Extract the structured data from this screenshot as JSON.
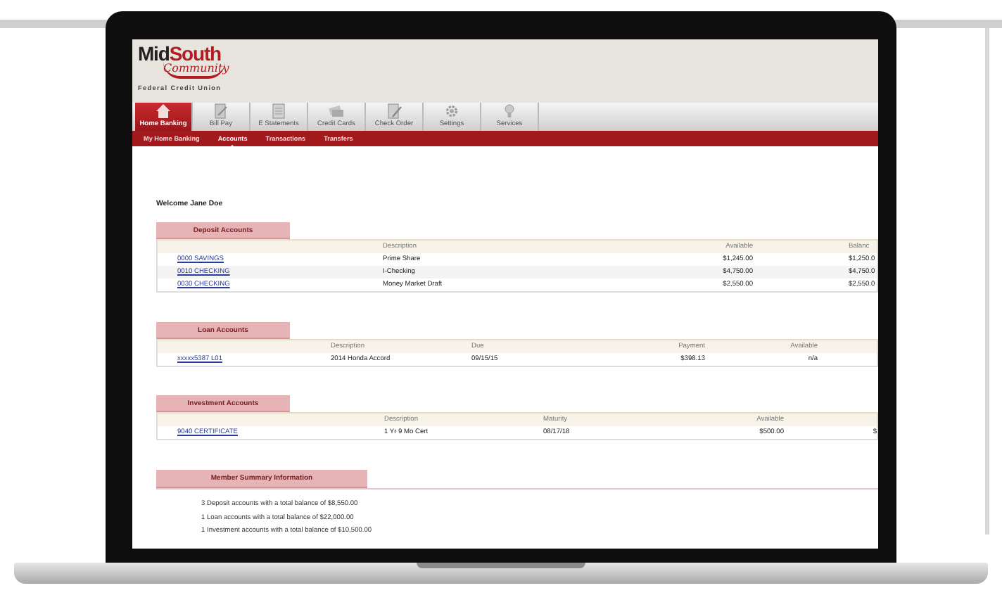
{
  "logo": {
    "name_dark": "Mid",
    "name_red": "South",
    "script": "Community",
    "tagline": "Federal Credit Union"
  },
  "tabs": [
    {
      "label": "Home Banking",
      "selected": true
    },
    {
      "label": "Bill Pay",
      "selected": false
    },
    {
      "label": "E Statements",
      "selected": false
    },
    {
      "label": "Credit Cards",
      "selected": false
    },
    {
      "label": "Check Order",
      "selected": false
    },
    {
      "label": "Settings",
      "selected": false
    },
    {
      "label": "Services",
      "selected": false
    }
  ],
  "subnav": [
    {
      "label": "My Home Banking",
      "selected": false
    },
    {
      "label": "Accounts",
      "selected": true
    },
    {
      "label": "Transactions",
      "selected": false
    },
    {
      "label": "Transfers",
      "selected": false
    }
  ],
  "welcome": "Welcome Jane Doe",
  "sections": [
    {
      "title": "Deposit Accounts",
      "kind": "deposit",
      "columns": [
        "",
        "Description",
        "Available",
        "Balanc"
      ],
      "rows": [
        [
          "0000 SAVINGS",
          "Prime Share",
          "$1,245.00",
          "$1,250.0"
        ],
        [
          "0010 CHECKING",
          "I-Checking",
          "$4,750.00",
          "$4,750.0"
        ],
        [
          "0030 CHECKING",
          "Money Market Draft",
          "$2,550.00",
          "$2,550.0"
        ]
      ]
    },
    {
      "title": "Loan Accounts",
      "kind": "loan",
      "columns": [
        "",
        "Description",
        "Due",
        "Payment",
        "Available",
        ""
      ],
      "rows": [
        [
          "xxxxx5387 L01",
          "2014 Honda Accord",
          "09/15/15",
          "$398.13",
          "n/a",
          ""
        ]
      ]
    },
    {
      "title": "Investment Accounts",
      "kind": "investment",
      "columns": [
        "",
        "Description",
        "Maturity",
        "Available",
        ""
      ],
      "rows": [
        [
          "9040 CERTIFICATE",
          "1 Yr 9 Mo Cert",
          "08/17/18",
          "$500.00",
          "$"
        ]
      ]
    }
  ],
  "summary": {
    "title": "Member Summary Information",
    "lines": [
      "3 Deposit accounts with a total balance of $8,550.00",
      "1 Loan accounts with a total balance of $22,000.00",
      "1 Investment accounts with a total balance of $10,500.00"
    ]
  }
}
